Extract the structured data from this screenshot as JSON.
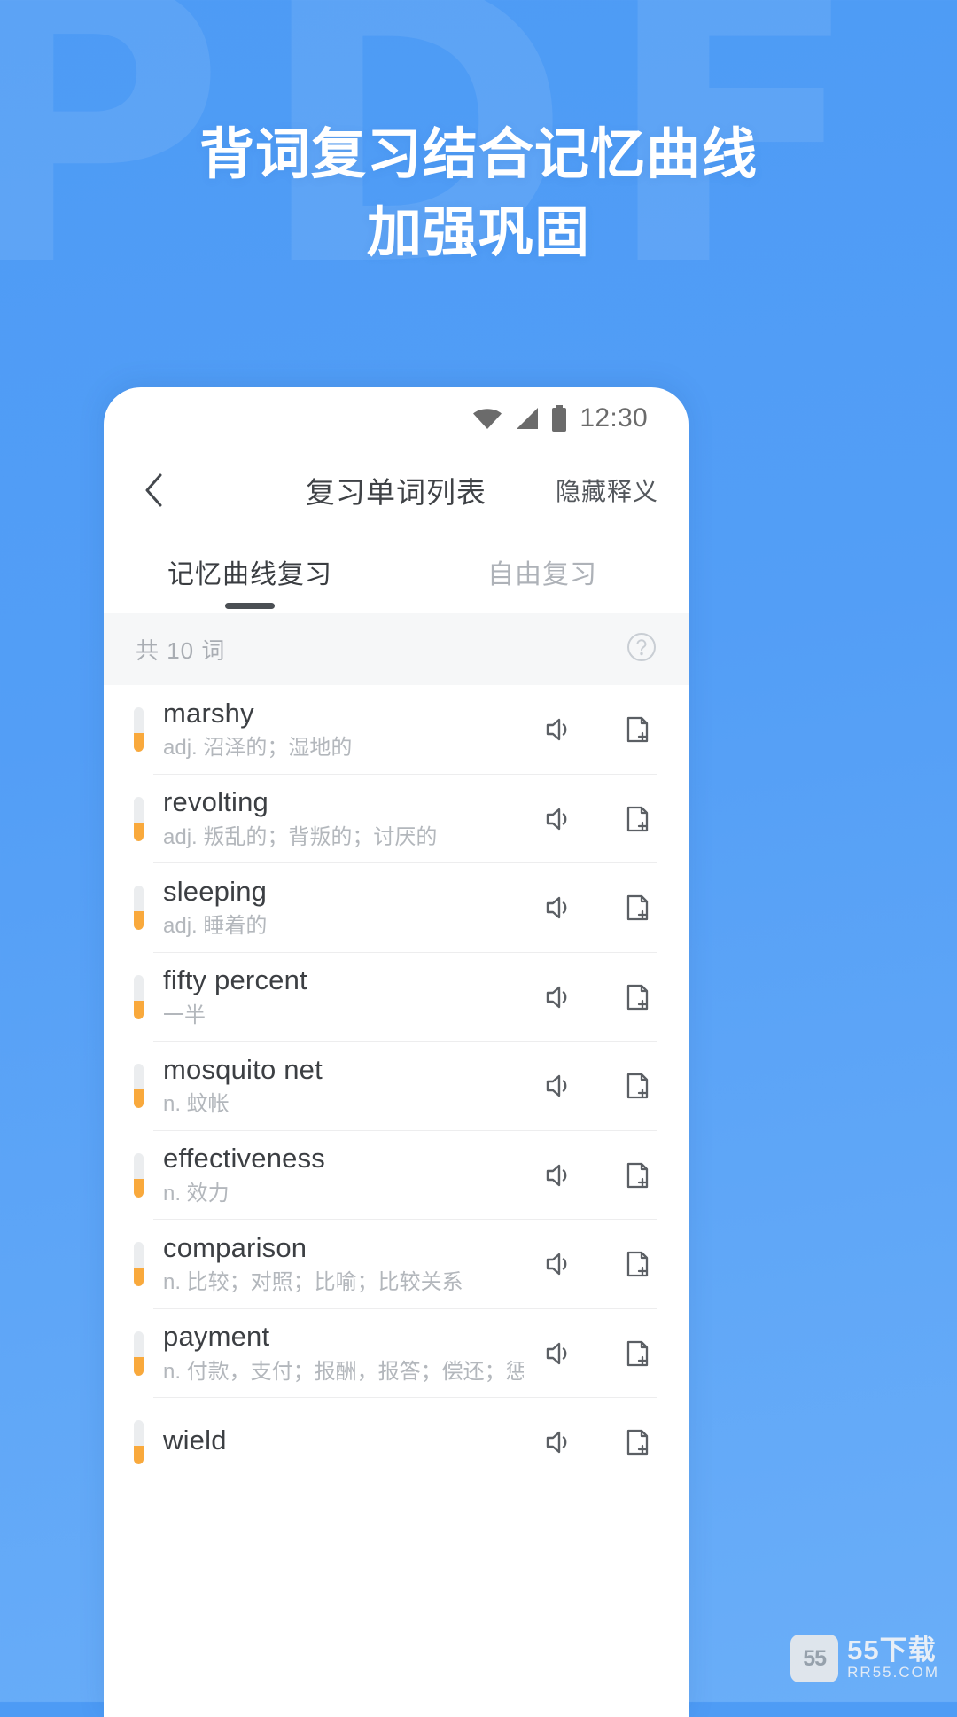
{
  "background": {
    "watermark_text": "PDF",
    "gradient_from": "#4d9bf5",
    "gradient_to": "#6aaef8"
  },
  "headline": {
    "line1": "背词复习结合记忆曲线",
    "line2": "加强巩固"
  },
  "phone": {
    "statusbar": {
      "wifi_icon": "wifi-icon",
      "signal_icon": "signal-icon",
      "battery_icon": "battery-icon",
      "time": "12:30"
    },
    "appbar": {
      "back_icon": "back-chevron-icon",
      "title": "复习单词列表",
      "action_label": "隐藏释义"
    },
    "tabs": [
      {
        "label": "记忆曲线复习",
        "active": true
      },
      {
        "label": "自由复习",
        "active": false
      }
    ],
    "countbar": {
      "count_text": "共 10 词",
      "help_icon": "question-mark-circle-icon"
    },
    "list": {
      "speaker_icon": "speaker-volume-icon",
      "add_icon": "add-to-notebook-icon",
      "rows": [
        {
          "word": "marshy",
          "meaning": "adj. 沼泽的；湿地的",
          "progress": 42
        },
        {
          "word": "revolting",
          "meaning": "adj. 叛乱的；背叛的；讨厌的",
          "progress": 42
        },
        {
          "word": "sleeping",
          "meaning": "adj. 睡着的",
          "progress": 42
        },
        {
          "word": "fifty percent",
          "meaning": "一半",
          "progress": 42
        },
        {
          "word": "mosquito net",
          "meaning": "n. 蚊帐",
          "progress": 42
        },
        {
          "word": "effectiveness",
          "meaning": "n. 效力",
          "progress": 42
        },
        {
          "word": "comparison",
          "meaning": "n. 比较；对照；比喻；比较关系",
          "progress": 42
        },
        {
          "word": "payment",
          "meaning": "n. 付款，支付；报酬，报答；偿还；惩罚，报应",
          "progress": 42
        },
        {
          "word": "wield",
          "meaning": "",
          "progress": 42
        }
      ]
    }
  },
  "site_badge": {
    "mark": "55",
    "name": "55下载",
    "domain": "RR55.COM"
  }
}
